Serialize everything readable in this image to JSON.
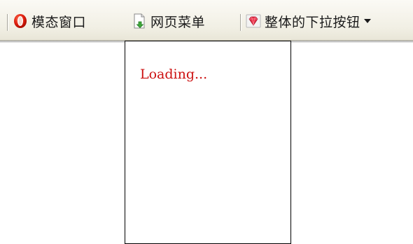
{
  "toolbar": {
    "modal_window": {
      "label": "模态窗口",
      "icon": "opera-icon"
    },
    "web_menu": {
      "label": "网页菜单",
      "icon": "page-download-icon"
    },
    "dropdown_button": {
      "label": "整体的下拉按钮",
      "icon": "ruby-gem-icon"
    }
  },
  "popup": {
    "status_text": "Loading..."
  },
  "colors": {
    "loading_text": "#cc1010",
    "toolbar_bg": "#f1efe4",
    "popup_border": "#000000"
  }
}
